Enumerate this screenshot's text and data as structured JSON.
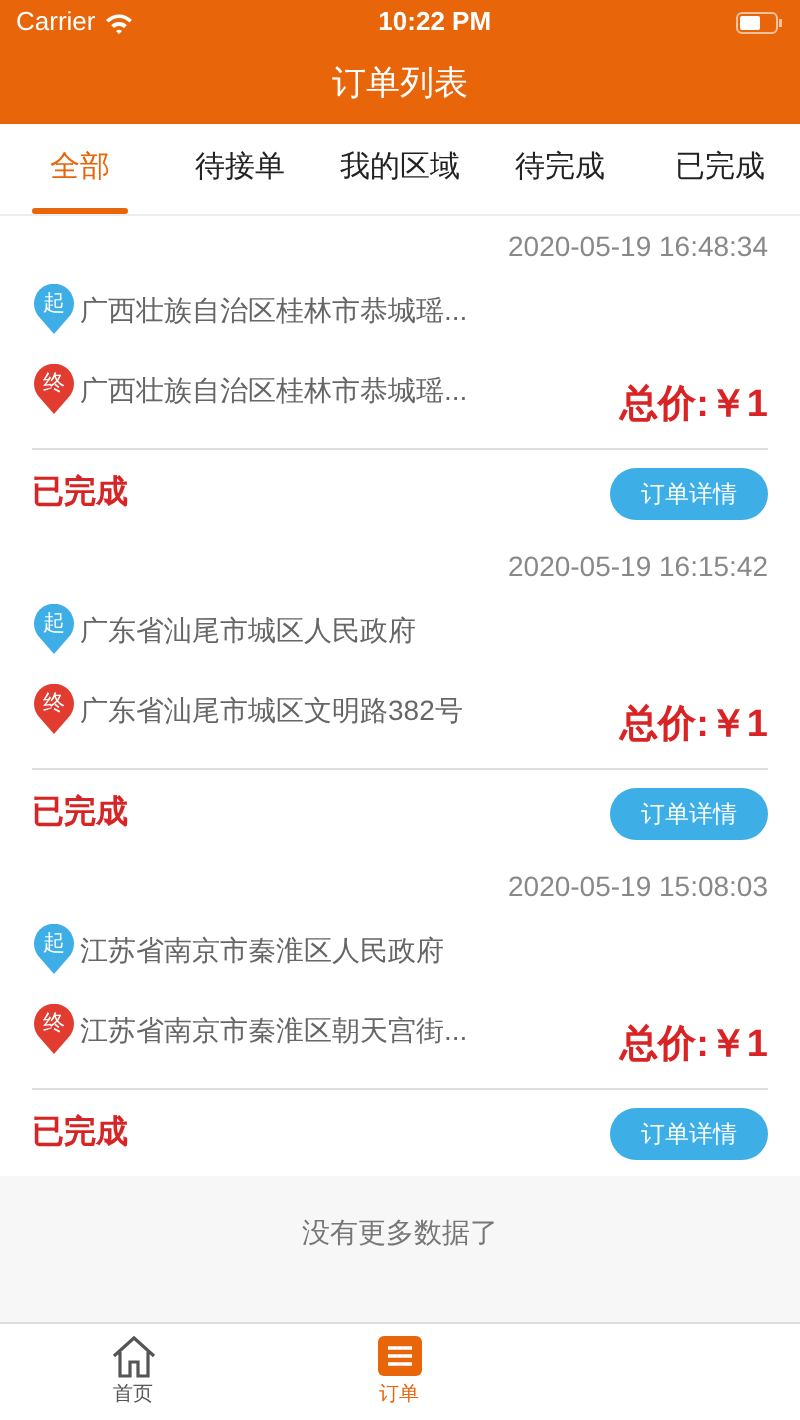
{
  "status_bar": {
    "carrier": "Carrier",
    "time": "10:22 PM"
  },
  "title": "订单列表",
  "tabs": [
    {
      "label": "全部",
      "selected": true
    },
    {
      "label": "待接单",
      "selected": false
    },
    {
      "label": "我的区域",
      "selected": false
    },
    {
      "label": "待完成",
      "selected": false
    },
    {
      "label": "已完成",
      "selected": false
    }
  ],
  "orders": [
    {
      "time": "2020-05-19 16:48:34",
      "start_badge": "起",
      "start": "广西壮族自治区桂林市恭城瑶...",
      "end_badge": "终",
      "end": "广西壮族自治区桂林市恭城瑶...",
      "price": "总价:￥1",
      "status": "已完成",
      "button": "订单详情"
    },
    {
      "time": "2020-05-19 16:15:42",
      "start_badge": "起",
      "start": "广东省汕尾市城区人民政府",
      "end_badge": "终",
      "end": "广东省汕尾市城区文明路382号",
      "price": "总价:￥1",
      "status": "已完成",
      "button": "订单详情"
    },
    {
      "time": "2020-05-19 15:08:03",
      "start_badge": "起",
      "start": "江苏省南京市秦淮区人民政府",
      "end_badge": "终",
      "end": "江苏省南京市秦淮区朝天宫街...",
      "price": "总价:￥1",
      "status": "已完成",
      "button": "订单详情"
    }
  ],
  "footer": "没有更多数据了",
  "bottom_tabs": [
    {
      "label": "首页",
      "kind": "home",
      "selected": false
    },
    {
      "label": "订单",
      "kind": "orders",
      "selected": true
    }
  ]
}
